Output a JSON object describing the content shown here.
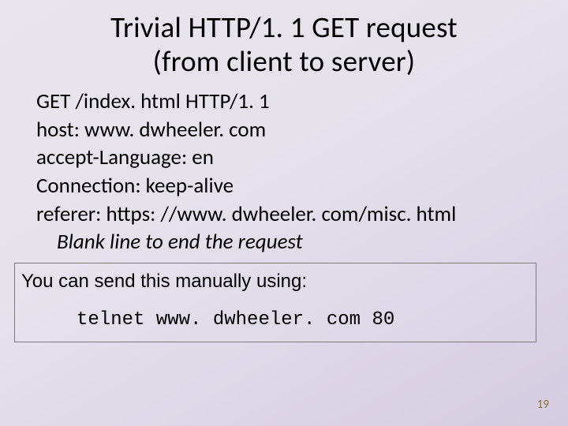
{
  "title_line1": "Trivial HTTP/1. 1 GET request",
  "title_line2": "(from client to server)",
  "lines": {
    "l1": "GET /index. html HTTP/1. 1",
    "l2": "host: www. dwheeler. com",
    "l3": "accept-Language: en",
    "l4": "Connection: keep-alive",
    "l5": "referer: https: //www. dwheeler. com/misc. html",
    "l6": "Blank line to end the request"
  },
  "note": {
    "intro": "You can send this manually using:",
    "cmd": "telnet www. dwheeler. com 80"
  },
  "page_number": "19"
}
